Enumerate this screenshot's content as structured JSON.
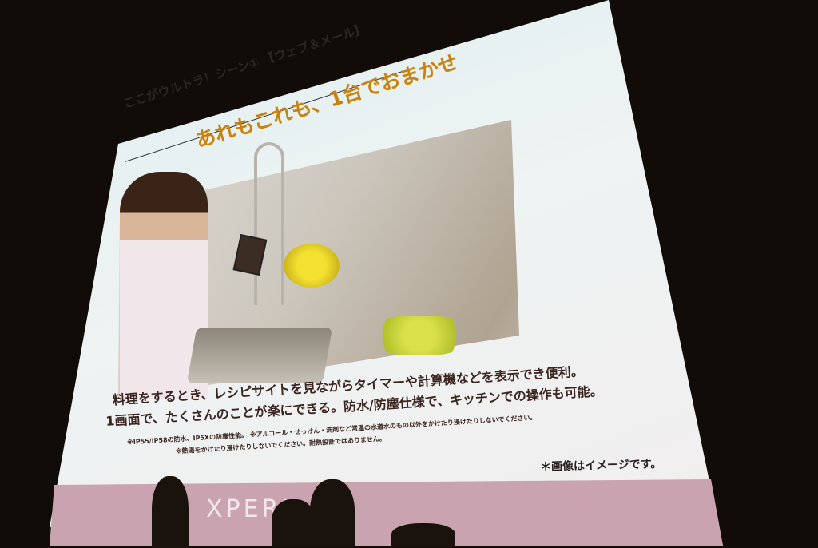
{
  "slide": {
    "header": "ここがウルトラ！シーン① 【ウェブ＆メール】",
    "title": "あれもこれも、1台でおまかせ",
    "body_line1": "料理をするとき、レシピサイトを見ながらタイマーや計算機などを表示でき便利。",
    "body_line2": "1画面で、たくさんのことが楽にできる。防水/防塵仕様で、キッチンでの操作も可能。",
    "note1": "※IP55/IP58の防水、IP5Xの防塵性能。 ※アルコール・せっけん・洗剤など常温の水道水のもの以外をかけたり浸けたりしないでください。",
    "note2": "※熱湯をかけたり浸けたりしないでください。耐熱設計ではありません。",
    "image_note": "＊画像はイメージです。",
    "brand": "XPERI"
  }
}
